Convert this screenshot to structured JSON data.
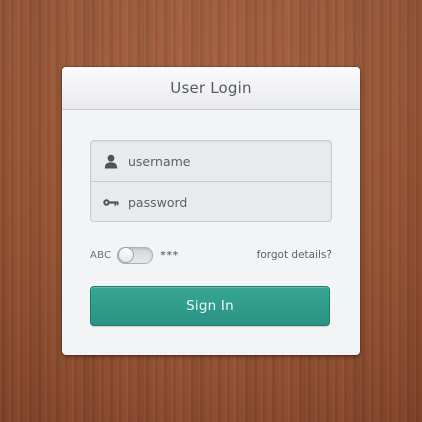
{
  "login_card": {
    "title": "User Login",
    "username_placeholder": "username",
    "password_placeholder": "password",
    "show_password_toggle": {
      "left_label": "ABC",
      "right_label": "***",
      "state": "off"
    },
    "forgot_link": "forgot details?",
    "submit_label": "Sign In"
  },
  "icons": {
    "username": "user-icon",
    "password": "key-icon"
  },
  "colors": {
    "accent": "#2f9a89",
    "background_wood": "#a85a34",
    "card_background": "#f3f4f5"
  }
}
